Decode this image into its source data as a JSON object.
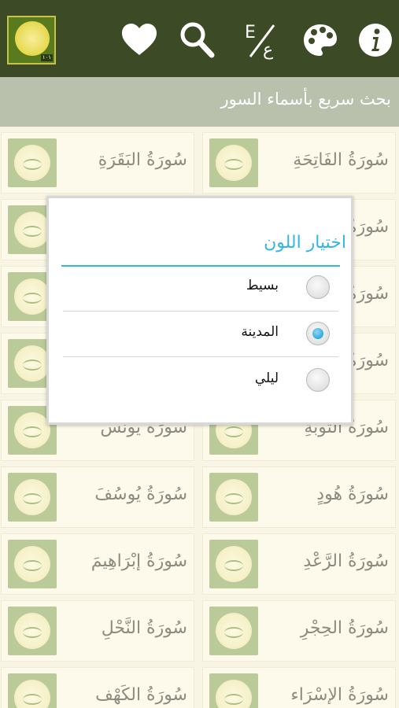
{
  "toolbar": {
    "app_badge": "١٠١",
    "icons": [
      "favorites-heart-icon",
      "search-icon",
      "language-toggle-icon",
      "palette-icon",
      "info-icon"
    ],
    "icon_color": "#ffffff",
    "bar_color": "#3c4b25"
  },
  "search": {
    "label": "بحث سريع بأسماء السور"
  },
  "surahs": [
    "سُورَةُ الفَاتِحَةِ",
    "سُورَةُ البَقَرَةِ",
    "سُورَةُ",
    "",
    "سُورَةُ",
    "",
    "سُورَةُ",
    "",
    "سُورَةُ التَّوبَةِ",
    "سُورَةُ يُونُس",
    "سُورَةُ هُودٍ",
    "سُورَةُ يُوسُفَ",
    "سُورَةُ الرَّعْدِ",
    "سُورَةُ إبْرَاهِيمَ",
    "سُورَةُ الحِجْرِ",
    "سُورَةُ النَّحْلِ",
    "سُورَةُ الإسْرَاء",
    "سُورَةُ الكَهْف"
  ],
  "dialog": {
    "title": "اختيار اللون",
    "accent": "#33b5e5",
    "options": [
      {
        "label": "بسيط",
        "selected": false
      },
      {
        "label": "المدينة",
        "selected": true
      },
      {
        "label": "ليلي",
        "selected": false
      }
    ]
  }
}
